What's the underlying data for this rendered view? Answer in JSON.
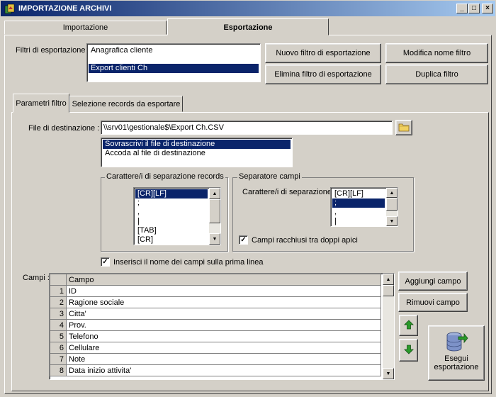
{
  "window": {
    "title": "IMPORTAZIONE ARCHIVI",
    "minimize": "_",
    "maximize": "□",
    "close": "×"
  },
  "tabs": {
    "import": "Importazione",
    "export": "Esportazione"
  },
  "filters": {
    "label": "Filtri di esportazione :",
    "items": [
      "Anagrafica cliente",
      "Export clienti Ch"
    ],
    "selected_index": 1
  },
  "buttons": {
    "new_filter": "Nuovo filtro di esportazione",
    "rename_filter": "Modifica nome filtro",
    "delete_filter": "Elimina filtro di esportazione",
    "duplicate_filter": "Duplica filtro",
    "add_field": "Aggiungi campo",
    "remove_field": "Rimuovi campo",
    "run_export": "Esegui esportazione"
  },
  "subtabs": {
    "params": "Parametri filtro",
    "records": "Selezione records da esportare"
  },
  "destination": {
    "label": "File di destinazione :",
    "value": "\\\\srv01\\gestionale$\\Export Ch.CSV",
    "modes": [
      "Sovrascrivi il file di destinazione",
      "Accoda al file di destinazione"
    ],
    "selected_mode": 0
  },
  "record_separator": {
    "legend": "Carattere/i di separazione records",
    "items": [
      "[CR][LF]",
      ";",
      ",",
      "|",
      "[TAB]",
      "[CR]"
    ]
  },
  "field_separator": {
    "legend": "Separatore campi",
    "label": "Carattere/i di separazione",
    "items": [
      "[CR][LF]",
      ";",
      ",",
      "|"
    ],
    "quote_label": "Campi racchiusi tra doppi apici",
    "quote_checked": true
  },
  "header_checkbox": {
    "label": "Inserisci il nome dei campi sulla prima linea",
    "checked": true
  },
  "fields": {
    "label": "Campi :",
    "column": "Campo",
    "rows": [
      {
        "n": "1",
        "name": "ID"
      },
      {
        "n": "2",
        "name": "Ragione sociale"
      },
      {
        "n": "3",
        "name": "Citta'"
      },
      {
        "n": "4",
        "name": "Prov."
      },
      {
        "n": "5",
        "name": "Telefono"
      },
      {
        "n": "6",
        "name": "Cellulare"
      },
      {
        "n": "7",
        "name": "Note"
      },
      {
        "n": "8",
        "name": "Data inizio attivita'"
      }
    ]
  },
  "icons": {
    "app": "app-icon",
    "folder": "folder-icon",
    "up": "arrow-up-icon",
    "down": "arrow-down-icon",
    "export": "database-export-icon"
  },
  "colors": {
    "selection": "#0a246a",
    "title_start": "#0a246a",
    "title_end": "#a6caf0",
    "green_arrow": "#2a9a2a"
  }
}
